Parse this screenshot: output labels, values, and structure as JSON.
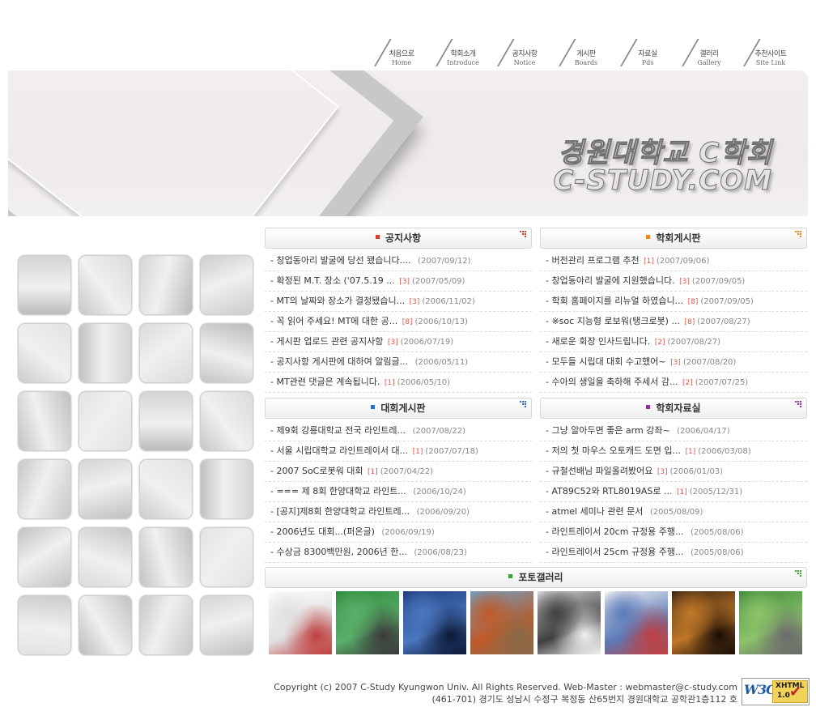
{
  "nav": [
    {
      "ko": "처음으로",
      "en": "Home"
    },
    {
      "ko": "학회소개",
      "en": "Introduce"
    },
    {
      "ko": "공지사항",
      "en": "Notice"
    },
    {
      "ko": "게시판",
      "en": "Boards"
    },
    {
      "ko": "자료실",
      "en": "Pds"
    },
    {
      "ko": "갤러리",
      "en": "Gallery"
    },
    {
      "ko": "추천사이트",
      "en": "Site Link"
    }
  ],
  "banner": {
    "title_line1": "경원대학교 C학회",
    "title_line2": "C-STUDY.COM"
  },
  "boards": {
    "notice": {
      "title": "공지사항",
      "accent": "#d83b2e",
      "posts": [
        {
          "title": "창업동아리 발굴에 당선 됐습니다....",
          "comments": "",
          "date": "(2007/09/12)"
        },
        {
          "title": "확정된 M.T. 장소 ('07.5.19 ...",
          "comments": "[3]",
          "date": "(2007/05/09)"
        },
        {
          "title": "MT의 날짜와 장소가 결정됐습니...",
          "comments": "[3]",
          "date": "(2006/11/02)"
        },
        {
          "title": "꼭 읽어 주세요! MT에 대한 공...",
          "comments": "[8]",
          "date": "(2006/10/13)"
        },
        {
          "title": "게시판 업로드 관련 공지사항",
          "comments": "[3]",
          "date": "(2006/07/19)"
        },
        {
          "title": "공지사항 게시판에 대하여 알림글...",
          "comments": "",
          "date": "(2006/05/11)"
        },
        {
          "title": "MT관련 댓글은 계속됩니다.",
          "comments": "[1]",
          "date": "(2006/05/10)"
        }
      ]
    },
    "freeboard": {
      "title": "학회게시판",
      "accent": "#e38a1f",
      "posts": [
        {
          "title": "버전관리 프로그램 추천",
          "comments": "[1]",
          "date": "(2007/09/06)"
        },
        {
          "title": "창업동아리 발굴에 지원했습니다.",
          "comments": "[3]",
          "date": "(2007/09/05)"
        },
        {
          "title": "학회 홈페이지를 리뉴얼 하였습니...",
          "comments": "[8]",
          "date": "(2007/09/05)"
        },
        {
          "title": "※soc 지능형 로보워(탱크로봇) ...",
          "comments": "[8]",
          "date": "(2007/08/27)"
        },
        {
          "title": "새로운 회장 인사드립니다.",
          "comments": "[2]",
          "date": "(2007/08/27)"
        },
        {
          "title": "모두들 시립대 대회 수고했어~",
          "comments": "[3]",
          "date": "(2007/08/20)"
        },
        {
          "title": "수아의 생일을 축하해 주세서 감...",
          "comments": "[2]",
          "date": "(2007/07/25)"
        }
      ]
    },
    "contest": {
      "title": "대회게시판",
      "accent": "#2e6fc6",
      "posts": [
        {
          "title": "제9회 강릉대학교 전국 라인트레...",
          "comments": "",
          "date": "(2007/08/22)"
        },
        {
          "title": "서울 시립대학교 라인트레이서 대...",
          "comments": "[1]",
          "date": "(2007/07/18)"
        },
        {
          "title": "2007 SoC로봇워 대회",
          "comments": "[1]",
          "date": "(2007/04/22)"
        },
        {
          "title": "=== 제 8회 한양대학교 라인트...",
          "comments": "",
          "date": "(2006/10/24)"
        },
        {
          "title": "[공지]제8회 한양대학교 라인트레...",
          "comments": "",
          "date": "(2006/09/20)"
        },
        {
          "title": "2006년도 대회...(퍼온글)",
          "comments": "",
          "date": "(2006/09/19)"
        },
        {
          "title": "수상금 8300백만원, 2006년 한...",
          "comments": "",
          "date": "(2006/08/23)"
        }
      ]
    },
    "pds": {
      "title": "학회자료실",
      "accent": "#9a2aa3",
      "posts": [
        {
          "title": "그냥 알아두면 좋은 arm 강좌~",
          "comments": "",
          "date": "(2006/04/17)"
        },
        {
          "title": "저의 첫 마우스 오토캐드 도면 입...",
          "comments": "[1]",
          "date": "(2006/03/08)"
        },
        {
          "title": "규철선배님 파일올려봤어요",
          "comments": "[3]",
          "date": "(2006/01/03)"
        },
        {
          "title": "AT89C52와 RTL8019AS로 ...",
          "comments": "[1]",
          "date": "(2005/12/31)"
        },
        {
          "title": "atmel 세미나 관련 문서",
          "comments": "",
          "date": "(2005/08/09)"
        },
        {
          "title": "라인트레이서 20cm 규정용 주행...",
          "comments": "",
          "date": "(2005/08/06)"
        },
        {
          "title": "라인트레이서 25cm 규정용 주행...",
          "comments": "",
          "date": "(2005/08/06)"
        }
      ]
    }
  },
  "gallery": {
    "title": "포토갤러리",
    "accent": "#3aa33a",
    "photos": [
      {
        "name": "photo-document",
        "colors": [
          "#ffffff",
          "#e0e0e0",
          "#c04040"
        ]
      },
      {
        "name": "photo-circuit-board",
        "colors": [
          "#2e8a3a",
          "#5ab06a",
          "#3a3a3a"
        ]
      },
      {
        "name": "photo-kaist-sdia",
        "colors": [
          "#1f3c7a",
          "#4a78c0",
          "#0d1a3a"
        ]
      },
      {
        "name": "photo-robot-parts",
        "colors": [
          "#6aa3c8",
          "#c05a2a",
          "#8a6a4a"
        ]
      },
      {
        "name": "photo-robot-art",
        "colors": [
          "#d8d8d8",
          "#404040",
          "#f0f0f0"
        ]
      },
      {
        "name": "photo-website",
        "colors": [
          "#f4f4f4",
          "#5a7ab8",
          "#c04040"
        ]
      },
      {
        "name": "photo-night-gathering",
        "colors": [
          "#3a2412",
          "#c07828",
          "#1a0e06"
        ]
      },
      {
        "name": "photo-park",
        "colors": [
          "#3e8a3a",
          "#8cc46a",
          "#6a6a6a"
        ]
      }
    ]
  },
  "footer": {
    "line1": "Copyright (c) 2007 C-Study Kyungwon Univ. All Rights Reserved. Web-Master : webmaster@c-study.com",
    "line2": "(461-701) 경기도 성남시 수정구 복정동 산65번지 경원대학교 공학관1층112 호",
    "badge": {
      "w3c": "W3C",
      "xhtml": "XHTML",
      "version": "1.0"
    }
  }
}
